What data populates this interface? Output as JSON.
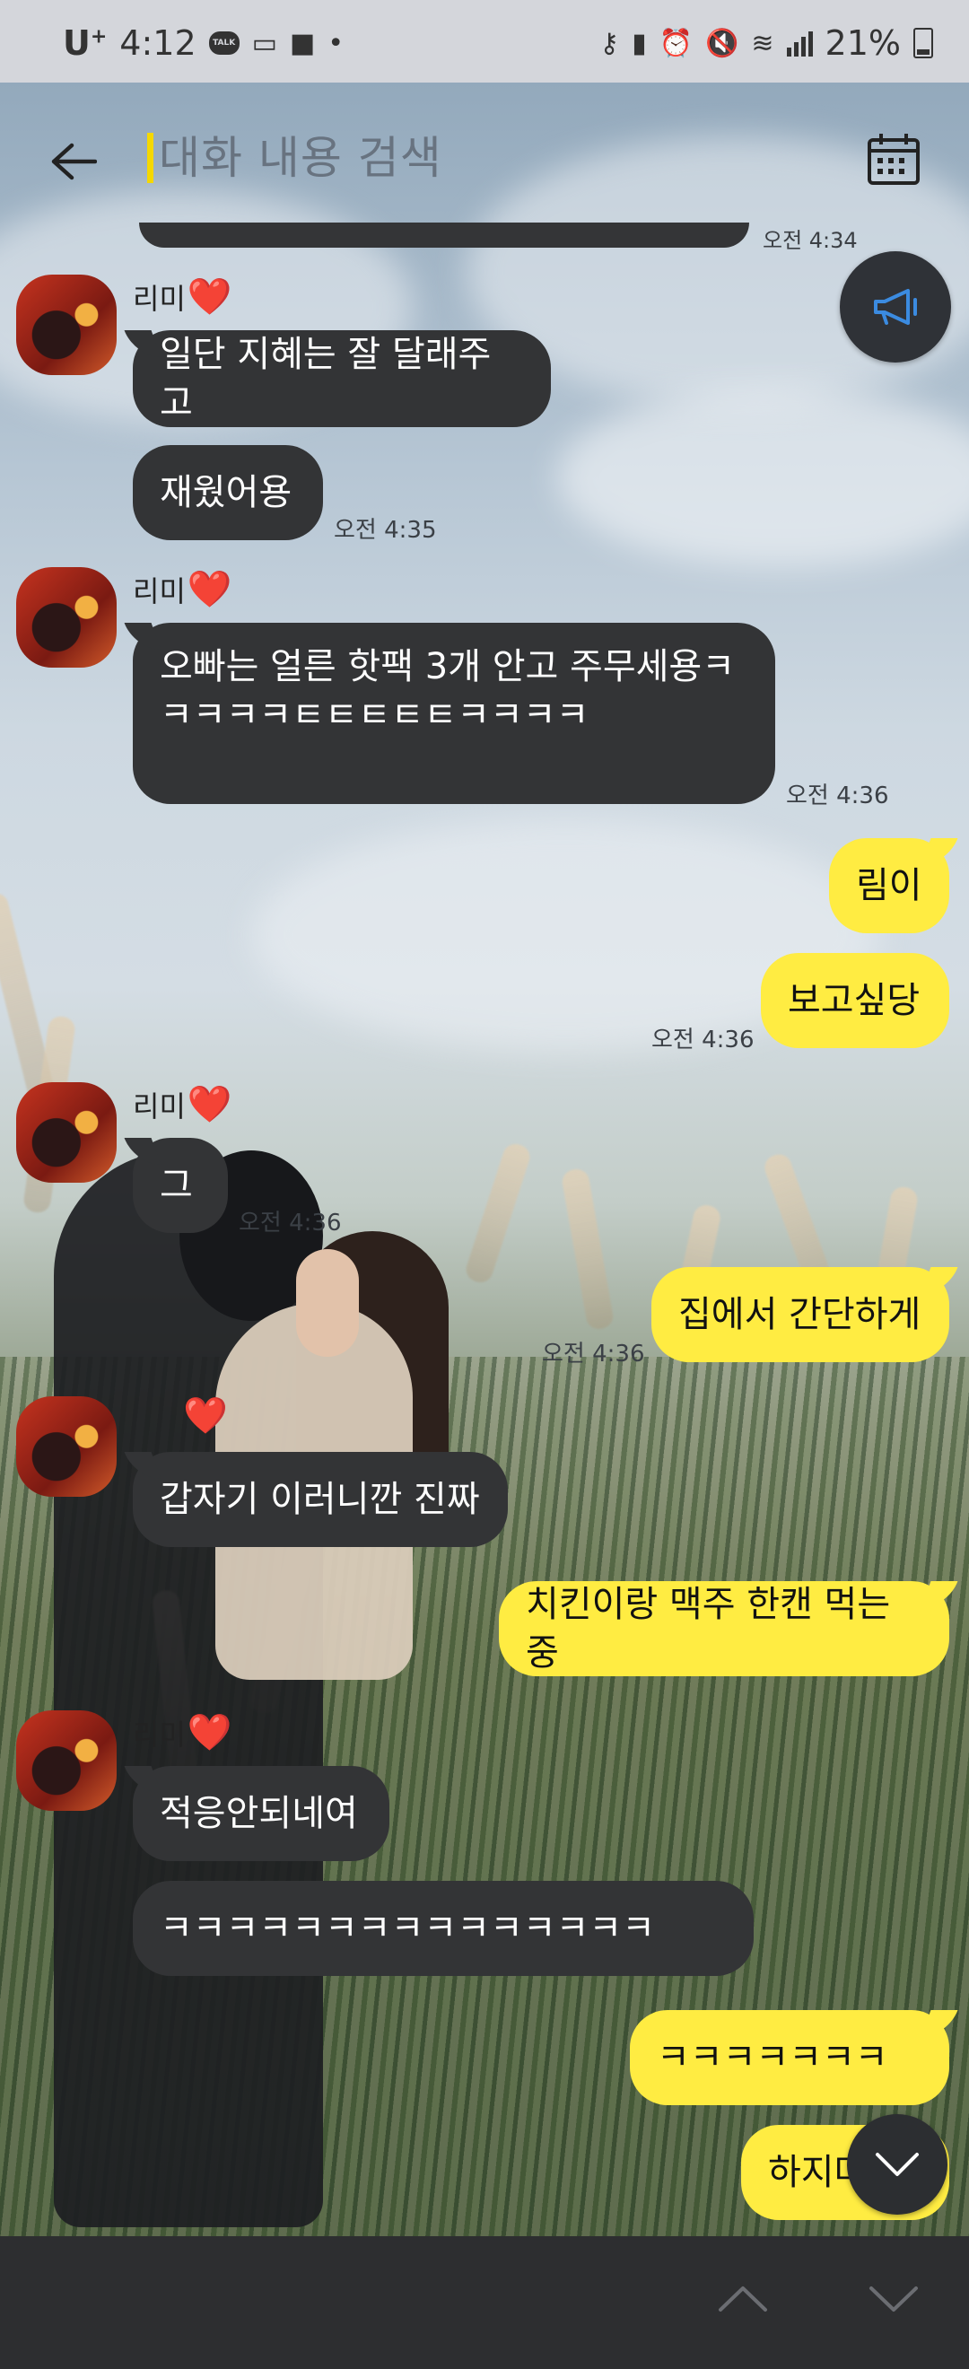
{
  "status_bar": {
    "carrier": "U",
    "carrier_sup": "+",
    "time": "4:12",
    "talk_badge": "TALK",
    "battery": "21%"
  },
  "search": {
    "placeholder": "대화 내용 검색",
    "value": ""
  },
  "icons": {
    "back": "arrow-left-icon",
    "calendar": "calendar-icon",
    "announce": "megaphone-icon",
    "scroll_down": "chevron-down-icon",
    "prev_result": "chevron-up-icon",
    "next_result": "chevron-down-icon"
  },
  "colors": {
    "incoming_bubble": "#333436",
    "outgoing_bubble": "#ffec42",
    "search_caret": "#f5d800",
    "bottom_bar": "#2d2e30"
  },
  "chat": {
    "top_cut_time": "오전 4:34",
    "sender_name": "리미",
    "sender_heart": "❤️",
    "messages": [
      {
        "dir": "in",
        "text": "일단 지혜는 잘 달래주고"
      },
      {
        "dir": "in",
        "text": "재웠어용",
        "time": "오전 4:35"
      },
      {
        "dir": "in",
        "text": "오빠는 얼른 핫팩 3개 안고 주무세용ㅋㅋㅋㅋㅋㅌㅌㅌㅌㅌㅋㅋㅋㅋ",
        "time": "오전 4:36"
      },
      {
        "dir": "out",
        "text": "림이"
      },
      {
        "dir": "out",
        "text": "보고싶당",
        "time": "오전 4:36"
      },
      {
        "dir": "in",
        "text": "그",
        "time": "오전 4:36"
      },
      {
        "dir": "out",
        "text": "집에서 간단하게",
        "time": "오전 4:36"
      },
      {
        "dir": "in",
        "text": "갑자기 이러니깐 진짜"
      },
      {
        "dir": "out",
        "text": "치킨이랑 맥주 한캔 먹는중"
      },
      {
        "dir": "in",
        "text": "적응안되네여"
      },
      {
        "dir": "in",
        "text": "ㅋㅋㅋㅋㅋㅋㅋㅋㅋㅋㅋㅋㅋㅋㅋ"
      },
      {
        "dir": "out",
        "text": "ㅋㅋㅋㅋㅋㅋㅋ"
      },
      {
        "dir": "out",
        "text": "하지마"
      }
    ]
  }
}
